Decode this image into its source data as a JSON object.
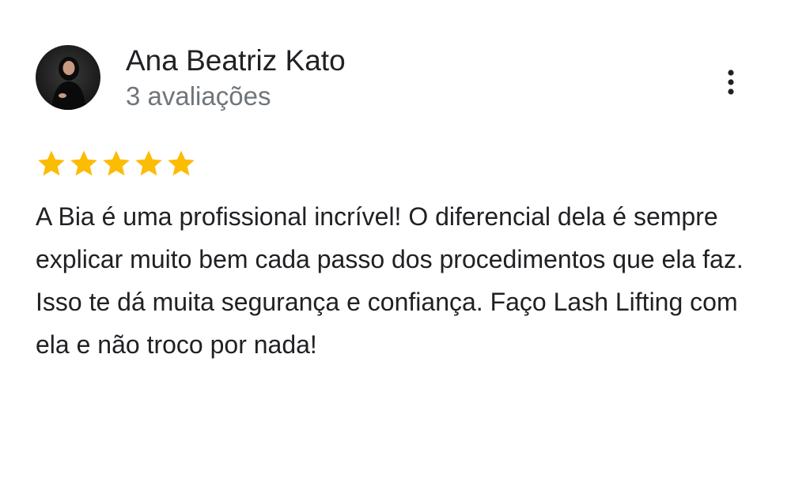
{
  "review": {
    "reviewer_name": "Ana Beatriz Kato",
    "review_count": "3 avaliações",
    "rating": 5,
    "max_rating": 5,
    "text": "A Bia é uma profissional incrível! O diferencial dela é sempre explicar muito bem cada passo dos procedimentos que ela faz. Isso te dá muita segurança e confiança. Faço Lash Lifting com ela e não troco por nada!"
  },
  "icons": {
    "avatar": "profile-photo",
    "more": "more-vert-icon",
    "star": "star-icon"
  },
  "colors": {
    "star": "#fbbc04",
    "text": "#202124",
    "secondary_text": "#70757a",
    "icon": "#202124"
  }
}
